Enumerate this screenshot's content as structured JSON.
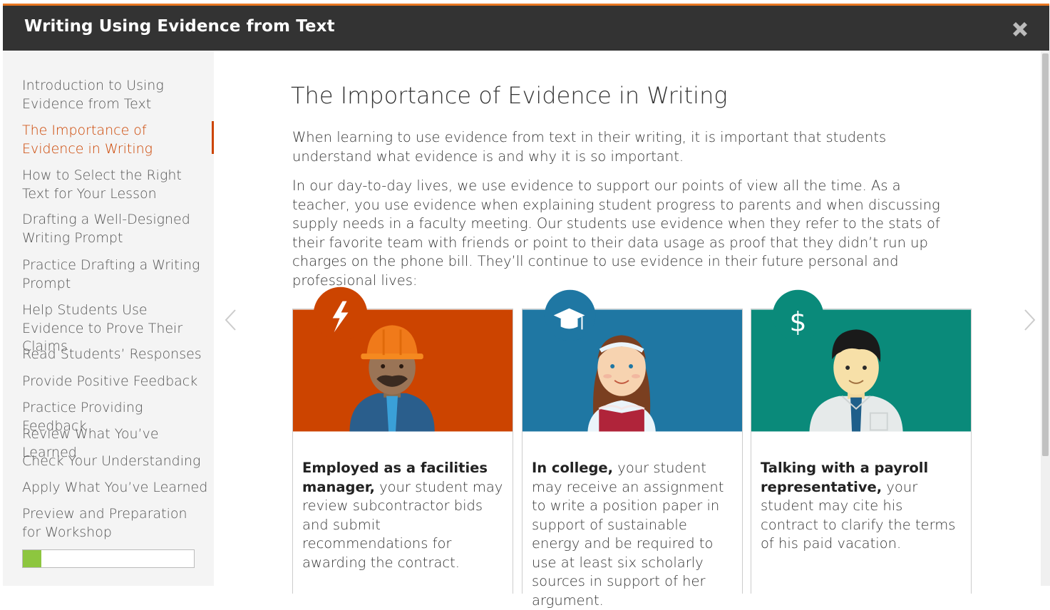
{
  "header": {
    "title": "Writing Using Evidence from Text"
  },
  "sidebar": {
    "items": [
      {
        "label": "Introduction to Using Evidence from Text"
      },
      {
        "label": "The Importance of Evidence in Writing"
      },
      {
        "label": "How to Select the Right Text for Your Lesson"
      },
      {
        "label": "Drafting a Well-Designed Writing Prompt"
      },
      {
        "label": "Practice Drafting a Writing Prompt"
      },
      {
        "label": "Help Students Use Evidence to Prove Their Claims"
      },
      {
        "label": "Read Students’ Responses"
      },
      {
        "label": "Provide Positive Feedback"
      },
      {
        "label": "Practice Providing Feedback"
      },
      {
        "label": "Review What You’ve Learned"
      },
      {
        "label": "Check Your Understanding"
      },
      {
        "label": "Apply What You’ve Learned"
      },
      {
        "label": "Preview and Preparation for Workshop"
      }
    ],
    "active_index": 1,
    "progress_fraction": 0.11
  },
  "main": {
    "title": "The Importance of Evidence in Writing",
    "paragraphs": [
      "When learning to use evidence from text in their writing, it is important that students understand what evidence is and why it is so important.",
      "In our day-to-day lives, we use evidence to support our points of view all the time. As a teacher, you use evidence when explaining student progress to parents and when discussing supply needs in a faculty meeting. Our students use evidence when they refer to the stats of their favorite team with friends or point to their data usage as proof that they didn’t run up charges on the phone bill. They’ll continue to use evidence in their future personal and professional lives:"
    ],
    "cards": [
      {
        "icon": "lightning-bolt-icon",
        "color": "#cc4400",
        "bold": "Employed as a facilities manager,",
        "text": " your student may review subcontractor bids and submit recommendations for awarding the contract."
      },
      {
        "icon": "graduation-cap-icon",
        "color": "#1f77a3",
        "bold": "In college,",
        "text": " your student may receive an assignment to write a position paper in support of sustainable energy and be required to use at least six scholarly sources in support of her argument."
      },
      {
        "icon": "dollar-sign-icon",
        "color": "#0a8a7a",
        "bold": "Talking with a payroll representative,",
        "text": " your student may cite his contract to clarify the terms of his paid vacation."
      }
    ]
  },
  "colors": {
    "header_bg": "#333333",
    "accent": "#e87722",
    "active": "#cc4400",
    "progress": "#8dc63f"
  }
}
